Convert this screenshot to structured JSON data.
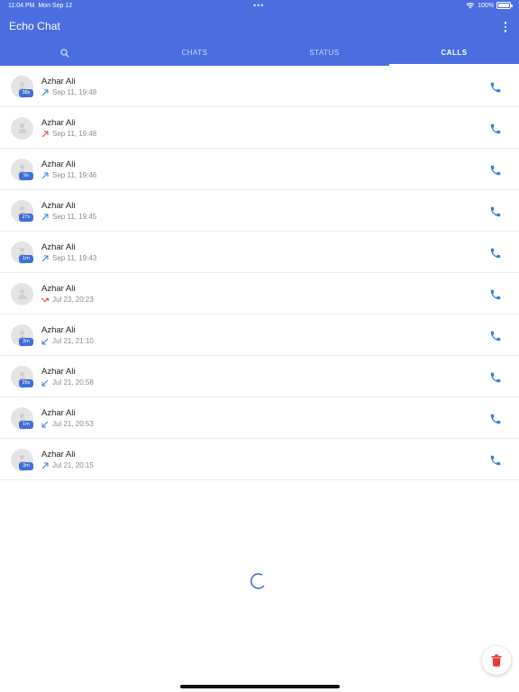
{
  "status_bar": {
    "time": "11:04 PM",
    "date": "Mon Sep 12",
    "battery": "100%"
  },
  "app": {
    "title": "Echo Chat"
  },
  "tabs": [
    {
      "icon": "search-icon",
      "label": ""
    },
    {
      "label": "CHATS"
    },
    {
      "label": "STATUS"
    },
    {
      "label": "CALLS",
      "active": true
    }
  ],
  "calls": [
    {
      "name": "Azhar Ali",
      "time": "Sep 11, 19:48",
      "duration": "38s",
      "direction": "outgoing"
    },
    {
      "name": "Azhar Ali",
      "time": "Sep 11, 19:48",
      "duration": "",
      "direction": "outgoing-missed"
    },
    {
      "name": "Azhar Ali",
      "time": "Sep 11, 19:46",
      "duration": "9s",
      "direction": "outgoing"
    },
    {
      "name": "Azhar Ali",
      "time": "Sep 11, 19:45",
      "duration": "27s",
      "direction": "outgoing"
    },
    {
      "name": "Azhar Ali",
      "time": "Sep 11, 19:43",
      "duration": "1m",
      "direction": "outgoing"
    },
    {
      "name": "Azhar Ali",
      "time": "Jul 23, 20:23",
      "duration": "",
      "direction": "missed"
    },
    {
      "name": "Azhar Ali",
      "time": "Jul 21, 21:10",
      "duration": "3m",
      "direction": "incoming"
    },
    {
      "name": "Azhar Ali",
      "time": "Jul 21, 20:58",
      "duration": "25s",
      "direction": "incoming"
    },
    {
      "name": "Azhar Ali",
      "time": "Jul 21, 20:53",
      "duration": "1m",
      "direction": "incoming"
    },
    {
      "name": "Azhar Ali",
      "time": "Jul 21, 20:15",
      "duration": "3m",
      "direction": "outgoing"
    }
  ],
  "colors": {
    "header": "#4a6ee0",
    "accent": "#2f7fe0",
    "missed": "#e53935",
    "delete": "#e53935"
  }
}
